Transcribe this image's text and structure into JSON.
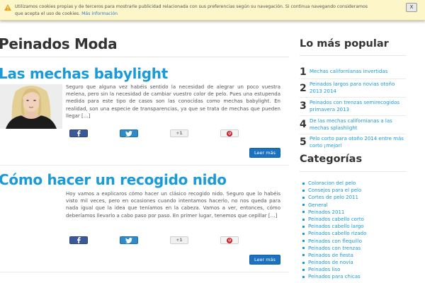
{
  "cookie_bar": {
    "text": "Utilizamos cookies propias y de terceros para mostrarle publicidad relacionada con sus preferencias según su navegación. Si continua navegando consideramos que acepta el uso de cookies.",
    "link_label": "Más información",
    "close_label": "X"
  },
  "site": {
    "title": "Peinados Moda"
  },
  "posts": [
    {
      "title": "Las mechas babylight",
      "excerpt": "Seguro que alguna vez habéis sentido la necesidad de alegrar un poco vuestra melena, pero sin la necesidad de cambiar vuestro color de pelo. Pues una estupenda medida para este tipo de casos son las conocidas como mechas babylight. En realidad, son una especie de transparencias, ya que se trata de mechas que pueden llegar […]",
      "read_more": "Leer más",
      "has_thumbnail": true
    },
    {
      "title": "Cómo hacer un recogido nido",
      "excerpt": "Hoy vamos a explicaros cómo hacer un clásico recogido nido. Seguro que lo habéis visto mil veces, pero en ocasiones cuando intentamos hacerlo, no nos queda para nada igual que la idea que teníamos en la cabeza. Vamos a ver, entonces, cómo deberíamos llevarlo a cabo paso por paso. En primer lugar, tenemos que cepillar […]",
      "read_more": "Leer más",
      "has_thumbnail": false
    }
  ],
  "share_buttons": {
    "googleplus_label": "+1"
  },
  "sidebar": {
    "popular_heading": "Lo más popular",
    "popular": [
      {
        "num": "1",
        "label": "Mechas californianas invertidas"
      },
      {
        "num": "2",
        "label": "Peinados largos para novias otoño 2013 2014"
      },
      {
        "num": "3",
        "label": "Peinados con trenzas semirecogidos primavera 2013"
      },
      {
        "num": "4",
        "label": "De las mechas californianas a las mechas splashlight"
      },
      {
        "num": "5",
        "label": "Pelo corto para otoño 2014 entre más corto ¡mejor!"
      }
    ],
    "categories_heading": "Categorías",
    "categories": [
      "Coloracion del pelo",
      "Consejos para el pelo",
      "Cortes de pelo 2011",
      "General",
      "Peinados 2011",
      "Peinados cabello corto",
      "Peinados cabello largo",
      "Peinados cabello rizado",
      "Peinados con flequillo",
      "Peinados con trenzas",
      "Peinados de fiesta",
      "Peinados de novia",
      "Peinados liso",
      "Peinados para chicas"
    ]
  },
  "colors": {
    "link_blue": "#1a9ad6",
    "button_blue": "#1a72c0",
    "cookie_bg": "#fcf6c8"
  }
}
